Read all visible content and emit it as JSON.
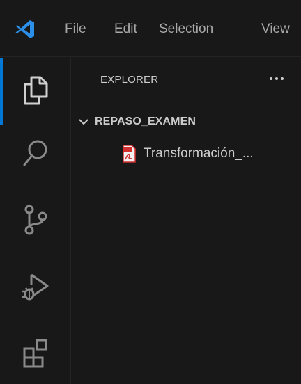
{
  "menu": {
    "items": [
      "File",
      "Edit",
      "Selection",
      "View"
    ]
  },
  "activity_bar": {
    "items": [
      {
        "icon": "files-icon",
        "active": true
      },
      {
        "icon": "search-icon",
        "active": false
      },
      {
        "icon": "source-control-icon",
        "active": false
      },
      {
        "icon": "run-debug-icon",
        "active": false
      },
      {
        "icon": "extensions-icon",
        "active": false
      }
    ]
  },
  "sidebar": {
    "title": "EXPLORER",
    "more_actions": "···",
    "folder": {
      "name": "REPASO_EXAMEN",
      "expanded": true,
      "files": [
        {
          "name": "Transformación_...",
          "icon": "pdf-file-icon"
        }
      ]
    }
  },
  "colors": {
    "background": "#181818",
    "text": "#cccccc",
    "menu_text": "#a8a8a8",
    "accent": "#0078d4",
    "logo": "#2b8fe8",
    "pdf_red": "#d32f2f"
  }
}
